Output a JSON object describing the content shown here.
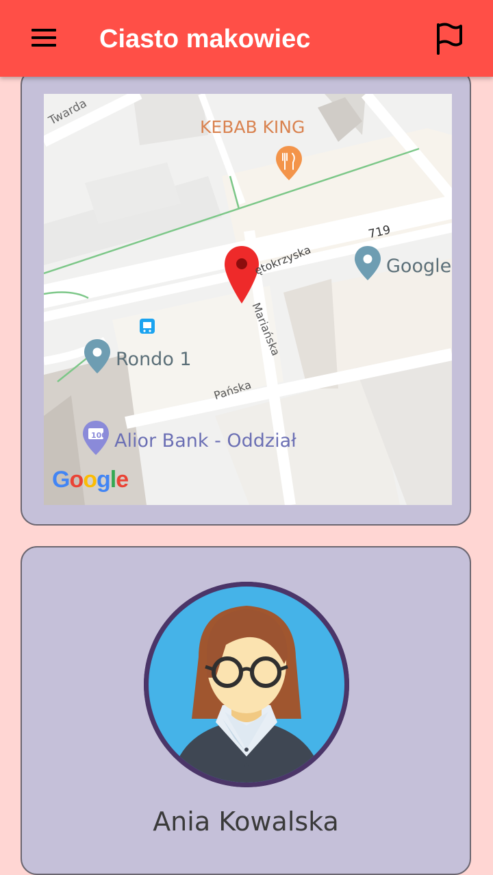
{
  "app_bar": {
    "title": "Ciasto makowiec",
    "menu_icon": "hamburger-menu-icon",
    "flag_icon": "flag-icon"
  },
  "map": {
    "streets": {
      "twarda": "Twarda",
      "swietokrzyska": "ętokrzyska",
      "marianska": "Mariańska",
      "panska": "Pańska",
      "road_number": "719"
    },
    "places": {
      "kebab": "KEBAB KING",
      "google": "Google",
      "rondo": "Rondo 1",
      "bank": "Alior Bank - Oddział"
    },
    "bank_icon_text": "100",
    "attribution": [
      "G",
      "o",
      "o",
      "g",
      "l",
      "e"
    ],
    "marker_color": "#ee2a2a"
  },
  "profile": {
    "name": "Ania Kowalska"
  },
  "colors": {
    "app_bar": "#ff4f47",
    "background": "#ffd6d3",
    "card": "#c5c0d9",
    "avatar_bg": "#45b3e8"
  }
}
